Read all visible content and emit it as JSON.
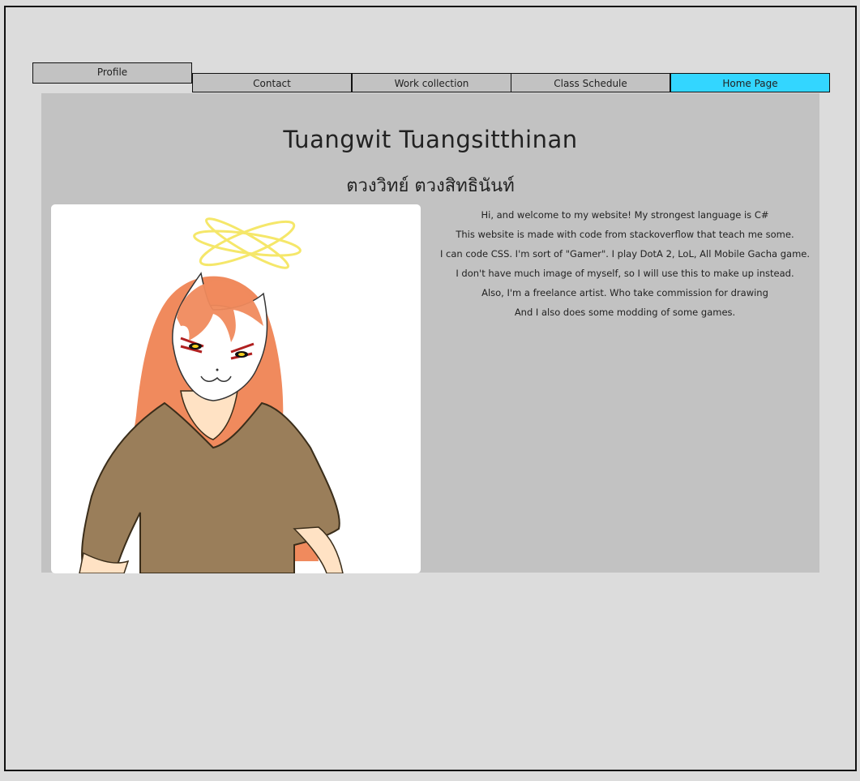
{
  "nav": {
    "tabs": [
      {
        "label": "Profile"
      },
      {
        "label": "Contact"
      },
      {
        "label": "Work collection"
      },
      {
        "label": "Class Schedule"
      },
      {
        "label": "Home Page"
      }
    ],
    "active_color": "#33d6ff"
  },
  "profile": {
    "name_en": "Tuangwit Tuangsitthinan",
    "name_th": "ตวงวิทย์ ตวงสิทธินันท์",
    "intro_lines": [
      "Hi, and welcome to my website! My strongest language is C#",
      "This website is made with code from stackoverflow that teach me some.",
      "I can code CSS. I'm sort of \"Gamer\". I play DotA 2, LoL, All Mobile Gacha game.",
      "I don't have much image of myself, so I will use this to make up instead.",
      "Also, I'm a freelance artist. Who take commission for drawing",
      "And I also does some modding of some games."
    ]
  },
  "colors": {
    "background": "#dcdcdc",
    "panel": "#c2c2c2",
    "hair": "#f08a5d",
    "shirt": "#9a7e5a",
    "halo": "#f5e76a"
  }
}
